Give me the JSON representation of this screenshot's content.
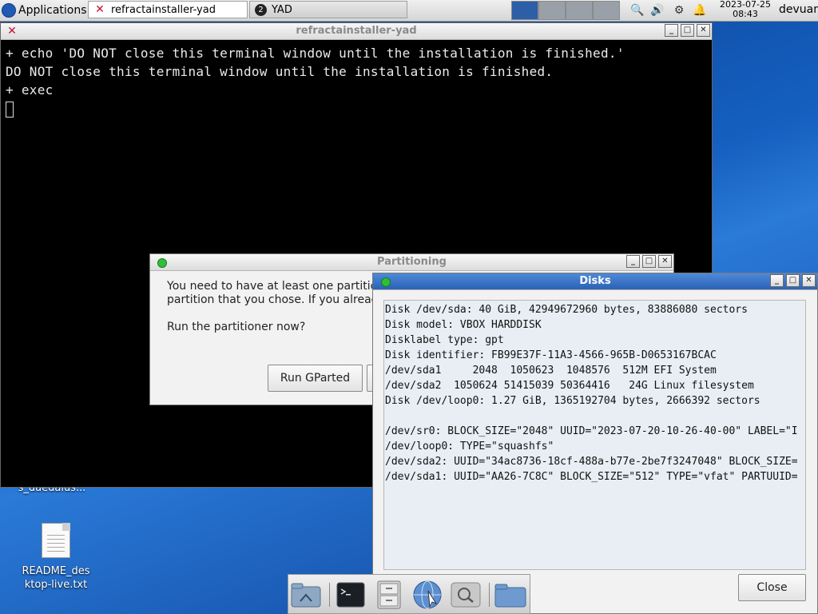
{
  "panel": {
    "apps_label": "Applications",
    "menu_sep": "☰",
    "task_active_label": "refractainstaller-yad",
    "task_yad_label": "YAD",
    "task_yad_badge": "2",
    "clock_date": "2023-07-25",
    "clock_time": "08:43",
    "user": "devuan"
  },
  "terminal": {
    "title": "refractainstaller-yad",
    "lines": [
      "+ echo 'DO NOT close this terminal window until the installation is finished.'",
      "DO NOT close this terminal window until the installation is finished.",
      "+ exec"
    ]
  },
  "partition": {
    "title": "Partitioning",
    "text1": "You need to have at least one partition",
    "text2": "partition that you chose. If you already",
    "text3": "Run the partitioner now?",
    "run_gparted": "Run GParted"
  },
  "disks": {
    "title": "Disks",
    "lines": [
      "Disk /dev/sda: 40 GiB, 42949672960 bytes, 83886080 sectors",
      "Disk model: VBOX HARDDISK",
      "Disklabel type: gpt",
      "Disk identifier: FB99E37F-11A3-4566-965B-D0653167BCAC",
      "/dev/sda1     2048  1050623  1048576  512M EFI System",
      "/dev/sda2  1050624 51415039 50364416   24G Linux filesystem",
      "Disk /dev/loop0: 1.27 GiB, 1365192704 bytes, 2666392 sectors",
      "",
      "/dev/sr0: BLOCK_SIZE=\"2048\" UUID=\"2023-07-20-10-26-40-00\" LABEL=\"I",
      "/dev/loop0: TYPE=\"squashfs\"",
      "/dev/sda2: UUID=\"34ac8736-18cf-488a-b77e-2be7f3247048\" BLOCK_SIZE=",
      "/dev/sda1: UUID=\"AA26-7C8C\" BLOCK_SIZE=\"512\" TYPE=\"vfat\" PARTUUID="
    ],
    "close_label": "Close"
  },
  "desktop": {
    "partial_label": "s_daedalus...",
    "readme_line1": "README_des",
    "readme_line2": "ktop-live.txt"
  }
}
